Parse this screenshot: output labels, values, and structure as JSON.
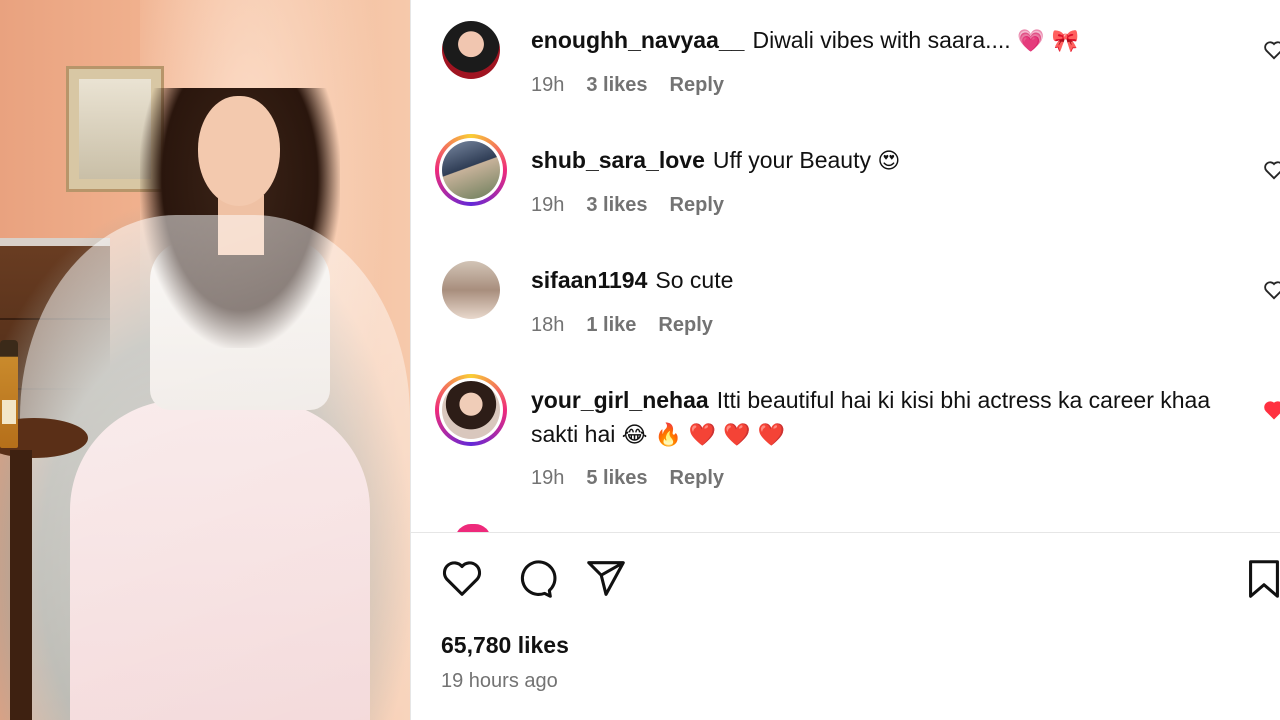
{
  "comments": [
    {
      "username": "enoughh_navyaa__",
      "text": "Diwali vibes with saara....",
      "emojis": "💗 🎀",
      "time": "19h",
      "likes": "3 likes",
      "reply": "Reply",
      "avatar_style": "plain",
      "liked": false
    },
    {
      "username": "shub_sara_love",
      "text": "Uff your Beauty",
      "emojis": "😍",
      "time": "19h",
      "likes": "3 likes",
      "reply": "Reply",
      "avatar_style": "story-ring",
      "liked": false
    },
    {
      "username": "sifaan1194",
      "text": "So cute",
      "emojis": "",
      "time": "18h",
      "likes": "1 like",
      "reply": "Reply",
      "avatar_style": "plain",
      "liked": false
    },
    {
      "username": "your_girl_nehaa",
      "text": "Itti beautiful hai ki kisi bhi actress ka career khaa sakti hai",
      "emojis": "😂 🔥 ❤️ ❤️ ❤️",
      "time": "19h",
      "likes": "5 likes",
      "reply": "Reply",
      "avatar_style": "story-ring",
      "liked": true
    }
  ],
  "actions": {
    "like_icon": "heart-outline-icon",
    "comment_icon": "speech-bubble-icon",
    "share_icon": "paper-plane-icon",
    "save_icon": "bookmark-icon"
  },
  "post": {
    "likes_count": "65,780 likes",
    "time_ago": "19 hours ago"
  },
  "colors": {
    "meta_text": "#737373",
    "liked_heart": "#ff3040",
    "story_ring": "#ee2a7b"
  }
}
